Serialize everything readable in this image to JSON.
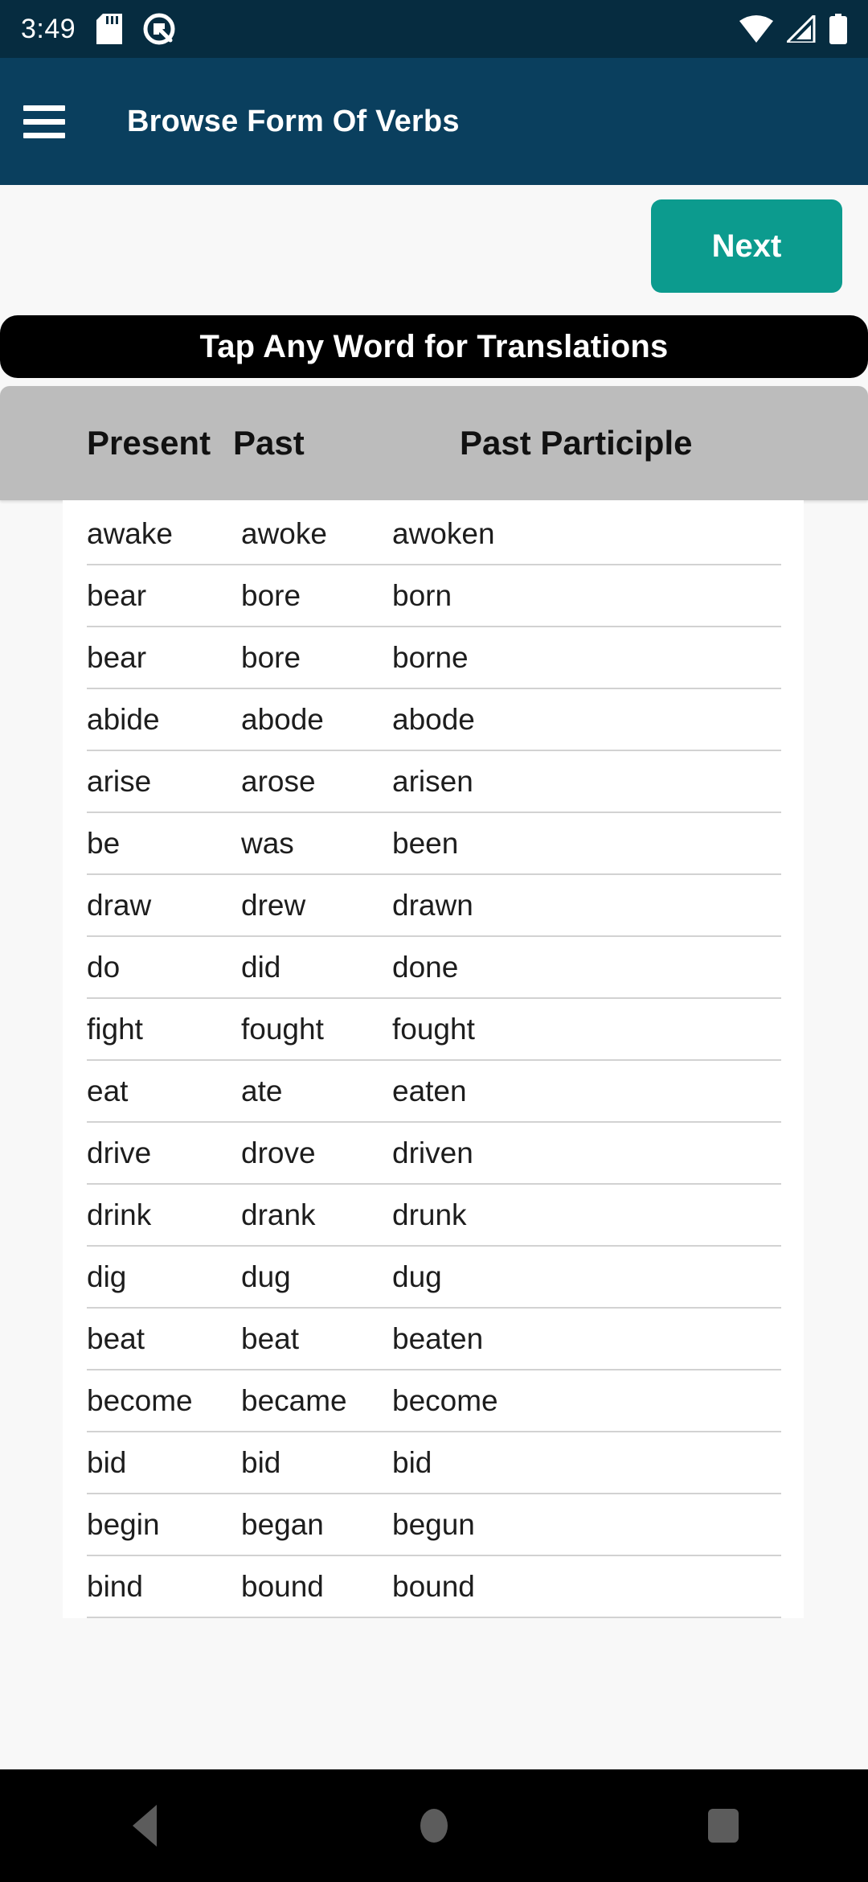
{
  "status_bar": {
    "time": "3:49",
    "icons_left": [
      "sd-card-icon",
      "data-saver-icon"
    ],
    "icons_right": [
      "wifi-icon",
      "cellular-signal-icon",
      "battery-icon"
    ],
    "background_color": "#062c40"
  },
  "app_bar": {
    "menu_icon": "hamburger-menu-icon",
    "title": "Browse Form Of Verbs",
    "background_color": "#0a3f5e",
    "text_color": "#ffffff"
  },
  "toolbar": {
    "next_label": "Next",
    "next_color": "#0c9b8e"
  },
  "banner": {
    "text": "Tap Any Word for Translations",
    "background_color": "#000000",
    "text_color": "#ffffff"
  },
  "table": {
    "header_background": "#bcbcbc",
    "columns": [
      "Present",
      "Past",
      "Past Participle"
    ],
    "rows": [
      {
        "present": "awake",
        "past": "awoke",
        "participle": "awoken"
      },
      {
        "present": "bear",
        "past": "bore",
        "participle": "born"
      },
      {
        "present": "bear",
        "past": "bore",
        "participle": "borne"
      },
      {
        "present": "abide",
        "past": "abode",
        "participle": "abode"
      },
      {
        "present": "arise",
        "past": "arose",
        "participle": "arisen"
      },
      {
        "present": "be",
        "past": "was",
        "participle": "been"
      },
      {
        "present": "draw",
        "past": "drew",
        "participle": "drawn"
      },
      {
        "present": "do",
        "past": "did",
        "participle": "done"
      },
      {
        "present": "fight",
        "past": "fought",
        "participle": "fought"
      },
      {
        "present": "eat",
        "past": "ate",
        "participle": "eaten"
      },
      {
        "present": "drive",
        "past": "drove",
        "participle": "driven"
      },
      {
        "present": "drink",
        "past": "drank",
        "participle": "drunk"
      },
      {
        "present": "dig",
        "past": "dug",
        "participle": "dug"
      },
      {
        "present": "beat",
        "past": "beat",
        "participle": "beaten"
      },
      {
        "present": "become",
        "past": "became",
        "participle": "become"
      },
      {
        "present": "bid",
        "past": "bid",
        "participle": "bid"
      },
      {
        "present": "begin",
        "past": "began",
        "participle": "begun"
      },
      {
        "present": "bind",
        "past": "bound",
        "participle": "bound"
      }
    ]
  },
  "nav_bar": {
    "background_color": "#000000",
    "icon_color": "#5c5c5c",
    "buttons": [
      "back-button",
      "home-button",
      "recents-button"
    ]
  }
}
